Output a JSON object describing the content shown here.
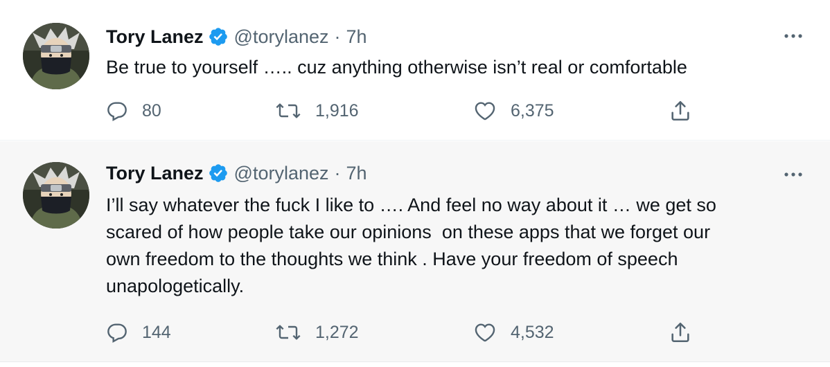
{
  "tweets": [
    {
      "display_name": "Tory Lanez",
      "handle": "@torylanez",
      "separator": "·",
      "time": "7h",
      "text": "Be true to yourself ….. cuz anything otherwise isn’t real or comfortable",
      "replies": "80",
      "retweets": "1,916",
      "likes": "6,375",
      "icons": [
        "verified-badge-icon",
        "more-options-icon",
        "reply-icon",
        "retweet-icon",
        "like-icon",
        "share-icon"
      ]
    },
    {
      "display_name": "Tory Lanez",
      "handle": "@torylanez",
      "separator": "·",
      "time": "7h",
      "text": "I’ll say whatever the fuck I like to …. And feel no way about it … we get so\nscared of how people take our opinions  on these apps that we forget our\nown freedom to the thoughts we think . Have your freedom of speech\nunapologetically.",
      "replies": "144",
      "retweets": "1,272",
      "likes": "4,532",
      "icons": [
        "verified-badge-icon",
        "more-options-icon",
        "reply-icon",
        "retweet-icon",
        "like-icon",
        "share-icon"
      ]
    }
  ],
  "colors": {
    "verified": "#1d9bf0",
    "secondary_text": "#536471",
    "primary_text": "#0f1419"
  }
}
